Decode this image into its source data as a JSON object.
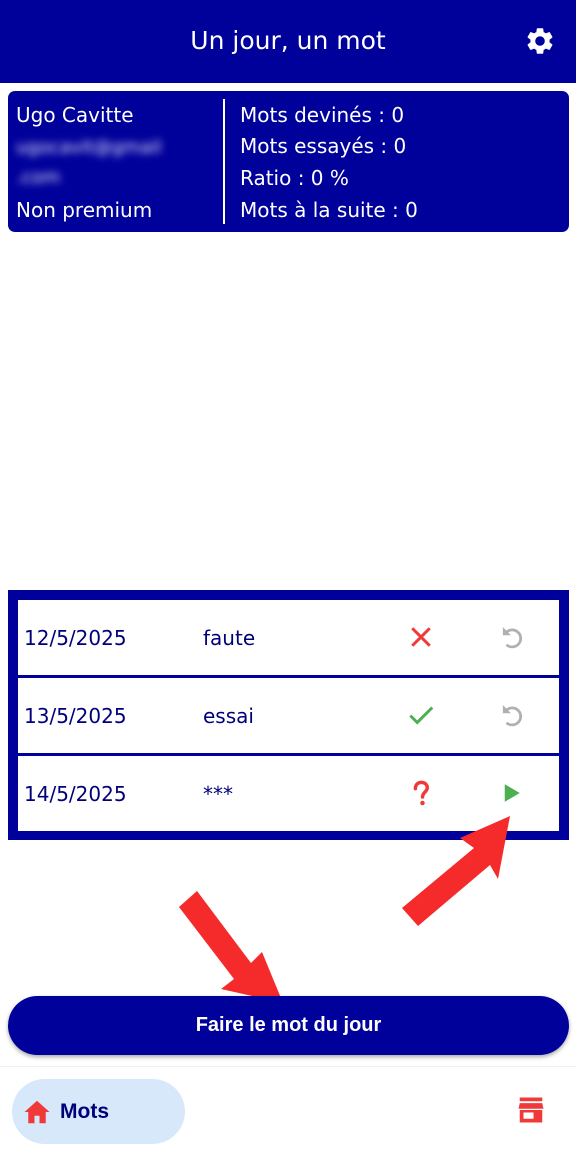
{
  "header": {
    "title": "Un jour, un mot",
    "settings_icon": "gear-icon"
  },
  "profile": {
    "name": "Ugo Cavitte",
    "email_line1": "ugocavit@gmail",
    "email_line2": ".com",
    "plan": "Non premium",
    "stats": {
      "guessed": "Mots devinés : 0",
      "tried": "Mots essayés : 0",
      "ratio": "Ratio : 0 %",
      "streak": "Mots à la suite : 0"
    }
  },
  "words": [
    {
      "date": "12/5/2025",
      "word": "faute",
      "status_icon": "cross-icon",
      "action_icon": "replay-icon"
    },
    {
      "date": "13/5/2025",
      "word": "essai",
      "status_icon": "check-icon",
      "action_icon": "replay-icon"
    },
    {
      "date": "14/5/2025",
      "word": "***",
      "status_icon": "question-icon",
      "action_icon": "play-icon"
    }
  ],
  "cta": {
    "label": "Faire le mot du jour"
  },
  "nav": {
    "home_label": "Mots",
    "home_icon": "home-icon",
    "store_icon": "store-icon"
  },
  "colors": {
    "primary": "#00009b",
    "accent_red": "#f03a3a",
    "success": "#4caf50",
    "grey": "#b0b0b0",
    "nav_pill": "#d7e8fb"
  }
}
